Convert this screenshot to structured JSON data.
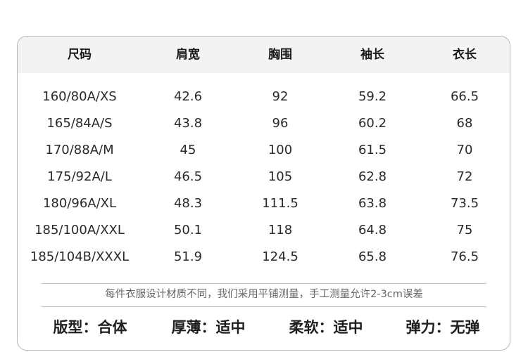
{
  "table": {
    "headers": [
      "尺码",
      "肩宽",
      "胸围",
      "袖长",
      "衣长"
    ],
    "rows": [
      [
        "160/80A/XS",
        "42.6",
        "92",
        "59.2",
        "66.5"
      ],
      [
        "165/84A/S",
        "43.8",
        "96",
        "60.2",
        "68"
      ],
      [
        "170/88A/M",
        "45",
        "100",
        "61.5",
        "70"
      ],
      [
        "175/92A/L",
        "46.5",
        "105",
        "62.8",
        "72"
      ],
      [
        "180/96A/XL",
        "48.3",
        "111.5",
        "63.8",
        "73.5"
      ],
      [
        "185/100A/XXL",
        "50.1",
        "118",
        "64.8",
        "75"
      ],
      [
        "185/104B/XXXL",
        "51.9",
        "124.5",
        "65.8",
        "76.5"
      ]
    ]
  },
  "note": "每件衣服设计材质不同，我们采用平铺测量，手工测量允许2-3cm误差",
  "attributes": [
    "版型：合体",
    "厚薄：适中",
    "柔软：适中",
    "弹力：无弹"
  ]
}
